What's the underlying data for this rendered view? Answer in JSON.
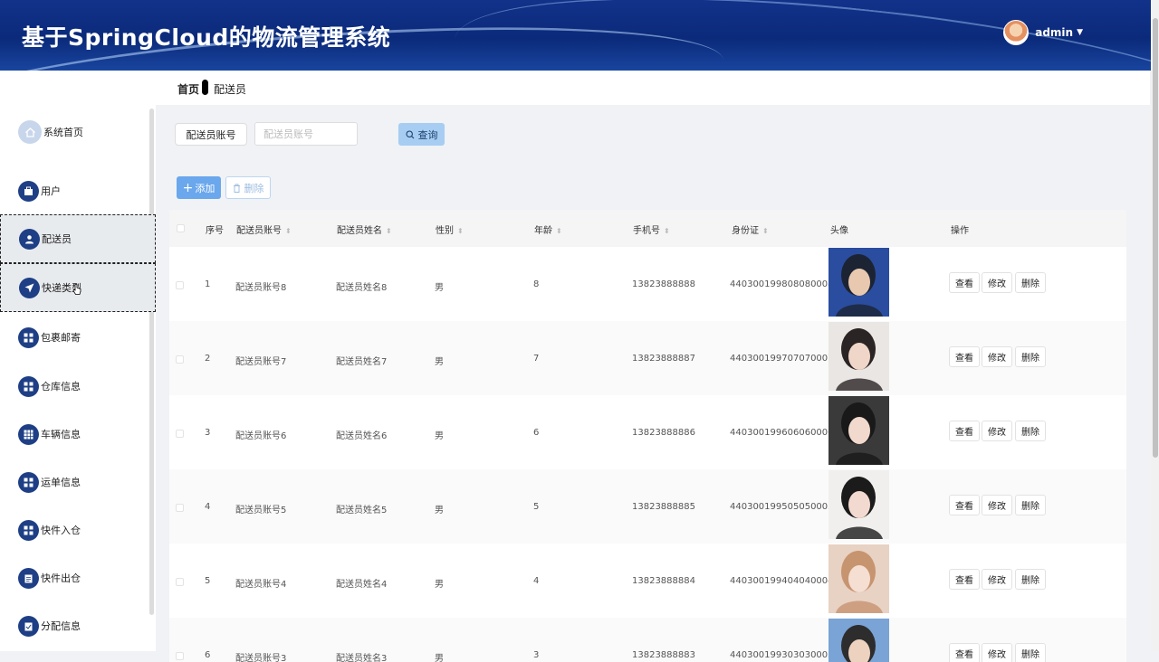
{
  "header": {
    "title": "基于SpringCloud的物流管理系统",
    "username": "admin"
  },
  "breadcrumb": {
    "home": "首页",
    "current": "配送员"
  },
  "sidebar": {
    "items": [
      {
        "label": "系统首页",
        "icon": "home-icon"
      },
      {
        "label": "用户",
        "icon": "briefcase-icon"
      },
      {
        "label": "配送员",
        "icon": "person-icon"
      },
      {
        "label": "快递类型",
        "icon": "send-icon"
      },
      {
        "label": "包裹邮寄",
        "icon": "grid-icon"
      },
      {
        "label": "仓库信息",
        "icon": "grid-icon"
      },
      {
        "label": "车辆信息",
        "icon": "grid-icon"
      },
      {
        "label": "运单信息",
        "icon": "grid-icon"
      },
      {
        "label": "快件入仓",
        "icon": "grid-icon"
      },
      {
        "label": "快件出仓",
        "icon": "clipboard-icon"
      },
      {
        "label": "分配信息",
        "icon": "clipboard-check-icon"
      }
    ]
  },
  "search": {
    "label": "配送员账号",
    "placeholder": "配送员账号",
    "value": "",
    "query_label": "查询"
  },
  "actions": {
    "add_label": "添加",
    "delete_label": "删除"
  },
  "table": {
    "headers": {
      "index": "序号",
      "account": "配送员账号",
      "name": "配送员姓名",
      "gender": "性别",
      "age": "年龄",
      "phone": "手机号",
      "idcard": "身份证",
      "avatar": "头像",
      "ops": "操作"
    },
    "op_labels": {
      "view": "查看",
      "edit": "修改",
      "delete": "删除"
    },
    "rows": [
      {
        "index": "1",
        "account": "配送员账号8",
        "name": "配送员姓名8",
        "gender": "男",
        "age": "8",
        "phone": "13823888888",
        "idcard": "440300199808080008"
      },
      {
        "index": "2",
        "account": "配送员账号7",
        "name": "配送员姓名7",
        "gender": "男",
        "age": "7",
        "phone": "13823888887",
        "idcard": "440300199707070007"
      },
      {
        "index": "3",
        "account": "配送员账号6",
        "name": "配送员姓名6",
        "gender": "男",
        "age": "6",
        "phone": "13823888886",
        "idcard": "440300199606060006"
      },
      {
        "index": "4",
        "account": "配送员账号5",
        "name": "配送员姓名5",
        "gender": "男",
        "age": "5",
        "phone": "13823888885",
        "idcard": "440300199505050005"
      },
      {
        "index": "5",
        "account": "配送员账号4",
        "name": "配送员姓名4",
        "gender": "男",
        "age": "4",
        "phone": "13823888884",
        "idcard": "440300199404040004"
      },
      {
        "index": "6",
        "account": "配送员账号3",
        "name": "配送员姓名3",
        "gender": "男",
        "age": "3",
        "phone": "13823888883",
        "idcard": "440300199303030003"
      }
    ]
  }
}
